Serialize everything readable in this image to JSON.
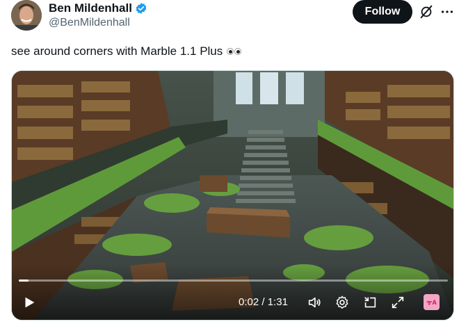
{
  "author": {
    "name": "Ben Mildenhall",
    "handle": "@BenMildenhall",
    "verified": true,
    "avatar_icon": "avatar-photo"
  },
  "actions": {
    "follow_label": "Follow",
    "grok_icon": "grok-icon",
    "more_icon": "more-icon"
  },
  "tweet": {
    "text": "see around corners with Marble 1.1 Plus",
    "emoji": "eyes-emoji"
  },
  "video": {
    "current_time": "0:02",
    "separator": "/",
    "duration": "1:31",
    "progress": 0.022,
    "controls": [
      "play-icon",
      "volume-icon",
      "settings-icon",
      "pip-icon",
      "fullscreen-icon",
      "captions-icon"
    ],
    "captions_label": "ᯤA"
  },
  "colors": {
    "verified_blue": "#1d9bf0",
    "follow_bg": "#0f1419",
    "text_primary": "#0f1419",
    "text_secondary": "#536471"
  }
}
